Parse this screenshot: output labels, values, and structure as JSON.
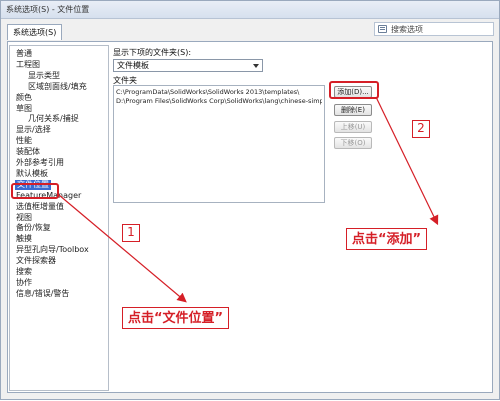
{
  "window": {
    "title": "系统选项(S) - 文件位置"
  },
  "tabs": [
    {
      "label": "系统选项(S)"
    }
  ],
  "search": {
    "text": "搜索选项"
  },
  "nav": {
    "items": [
      {
        "label": "普通",
        "indent": 0
      },
      {
        "label": "工程图",
        "indent": 0
      },
      {
        "label": "显示类型",
        "indent": 2
      },
      {
        "label": "区域剖面线/填充",
        "indent": 2
      },
      {
        "label": "颜色",
        "indent": 0
      },
      {
        "label": "草图",
        "indent": 0
      },
      {
        "label": "几何关系/捕捉",
        "indent": 2
      },
      {
        "label": "显示/选择",
        "indent": 0
      },
      {
        "label": "性能",
        "indent": 0
      },
      {
        "label": "装配体",
        "indent": 0
      },
      {
        "label": "外部参考引用",
        "indent": 0
      },
      {
        "label": "默认模板",
        "indent": 0
      },
      {
        "label": "文件位置",
        "indent": 0,
        "selected": true
      },
      {
        "label": "FeatureManager",
        "indent": 0
      },
      {
        "label": "选值框增量值",
        "indent": 0
      },
      {
        "label": "视图",
        "indent": 0
      },
      {
        "label": "备份/恢复",
        "indent": 0
      },
      {
        "label": "触摸",
        "indent": 0
      },
      {
        "label": "异型孔向导/Toolbox",
        "indent": 0
      },
      {
        "label": "文件探索器",
        "indent": 0
      },
      {
        "label": "搜索",
        "indent": 0
      },
      {
        "label": "协作",
        "indent": 0
      },
      {
        "label": "信息/错误/警告",
        "indent": 0
      }
    ]
  },
  "content": {
    "show_folders_label": "显示下项的文件夹(S):",
    "folder_type": "文件模板",
    "folders_label": "文件夹",
    "folders": [
      "C:\\ProgramData\\SolidWorks\\SolidWorks 2013\\templates\\",
      "D:\\Program Files\\SolidWorks Corp\\SolidWorks\\lang\\chinese-simplified\\Tutorial"
    ],
    "buttons": {
      "add": "添加(D)...",
      "delete": "删除(E)",
      "move_up": "上移(U)",
      "move_down": "下移(O)"
    }
  },
  "annotations": {
    "step1_number": "1",
    "step1_text": "点击“文件位置”",
    "step2_number": "2",
    "step2_text": "点击“添加”",
    "color": "#d51f27"
  }
}
